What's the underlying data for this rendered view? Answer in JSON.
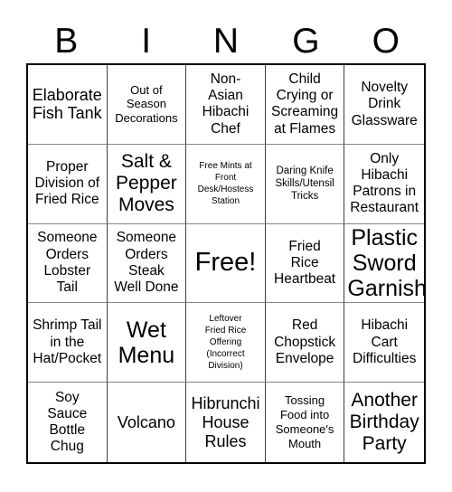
{
  "card": {
    "title_letters": [
      "B",
      "I",
      "N",
      "G",
      "O"
    ],
    "free_space_index": 12,
    "colors": {
      "text": "#000000",
      "background": "#ffffff",
      "border": "#000000",
      "grid_line": "#3f3f3f"
    },
    "cells": [
      {
        "text": "Elaborate\nFish Tank",
        "size": "l"
      },
      {
        "text": "Out of\nSeason\nDecorations",
        "size": "s"
      },
      {
        "text": "Non-\nAsian\nHibachi\nChef",
        "size": "m"
      },
      {
        "text": "Child\nCrying or\nScreaming\nat Flames",
        "size": "m"
      },
      {
        "text": "Novelty\nDrink\nGlassware",
        "size": "m"
      },
      {
        "text": "Proper\nDivision of\nFried Rice",
        "size": "m"
      },
      {
        "text": "Salt &\nPepper\nMoves",
        "size": "xl"
      },
      {
        "text": "Free Mints at\nFront\nDesk/Hostess\nStation",
        "size": "xxs"
      },
      {
        "text": "Daring Knife\nSkills/Utensil\nTricks",
        "size": "xs"
      },
      {
        "text": "Only\nHibachi\nPatrons in\nRestaurant",
        "size": "m"
      },
      {
        "text": "Someone\nOrders\nLobster\nTail",
        "size": "m"
      },
      {
        "text": "Someone\nOrders\nSteak\nWell Done",
        "size": "m"
      },
      {
        "text": "Free!",
        "size": "free"
      },
      {
        "text": "Fried\nRice\nHeartbeat",
        "size": "m"
      },
      {
        "text": "Plastic\nSword\nGarnish",
        "size": "xxl"
      },
      {
        "text": "Shrimp Tail\nin the\nHat/Pocket",
        "size": "m"
      },
      {
        "text": "Wet\nMenu",
        "size": "xxl"
      },
      {
        "text": "Leftover\nFried Rice\nOffering\n(Incorrect\nDivision)",
        "size": "xxs"
      },
      {
        "text": "Red\nChopstick\nEnvelope",
        "size": "m"
      },
      {
        "text": "Hibachi\nCart\nDifficulties",
        "size": "m"
      },
      {
        "text": "Soy\nSauce\nBottle\nChug",
        "size": "m"
      },
      {
        "text": "Volcano",
        "size": "l"
      },
      {
        "text": "Hibrunchi\nHouse\nRules",
        "size": "l"
      },
      {
        "text": "Tossing\nFood into\nSomeone's\nMouth",
        "size": "s"
      },
      {
        "text": "Another\nBirthday\nParty",
        "size": "xl"
      }
    ]
  }
}
